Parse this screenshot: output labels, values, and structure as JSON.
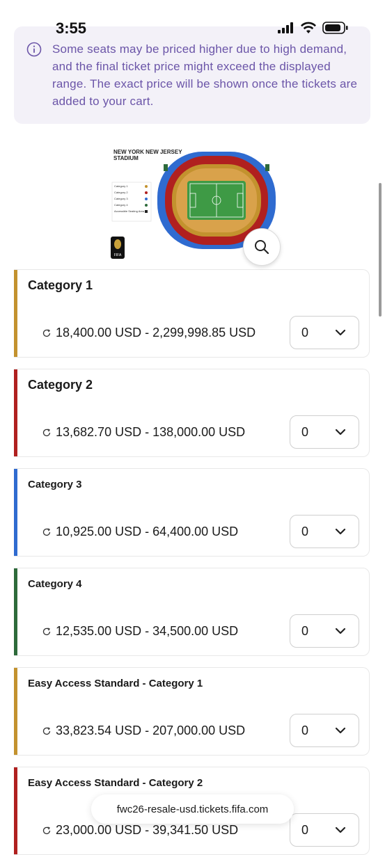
{
  "status": {
    "time": "3:55"
  },
  "notice": {
    "text": "Some seats may be priced higher due to high demand, and the final ticket price might exceed the displayed range. The exact price will be shown once the tickets are added to your cart.",
    "color": "#6b55a8"
  },
  "map": {
    "title_line1": "NEW YORK NEW JERSEY",
    "title_line2": "STADIUM",
    "legend": [
      "Category 1",
      "Category 2",
      "Category 3",
      "Category 4",
      "Accessible Seating Area"
    ],
    "emblem_text": "FIFA"
  },
  "categories": [
    {
      "name": "Category 1",
      "price": "18,400.00 USD - 2,299,998.85 USD",
      "qty": "0",
      "color": "#c3922e"
    },
    {
      "name": "Category 2",
      "price": "13,682.70 USD - 138,000.00 USD",
      "qty": "0",
      "color": "#b0201f"
    },
    {
      "name": "Category 3",
      "price": "10,925.00 USD - 64,400.00 USD",
      "qty": "0",
      "color": "#2f6bd0"
    },
    {
      "name": "Category 4",
      "price": "12,535.00 USD - 34,500.00 USD",
      "qty": "0",
      "color": "#2d6a3a"
    },
    {
      "name": "Easy Access Standard - Category 1",
      "price": "33,823.54 USD - 207,000.00 USD",
      "qty": "0",
      "color": "#c3922e"
    },
    {
      "name": "Easy Access Standard - Category 2",
      "price": "23,000.00 USD - 39,341.50 USD",
      "qty": "0",
      "color": "#b0201f"
    }
  ],
  "browser": {
    "url": "fwc26-resale-usd.tickets.fifa.com"
  }
}
